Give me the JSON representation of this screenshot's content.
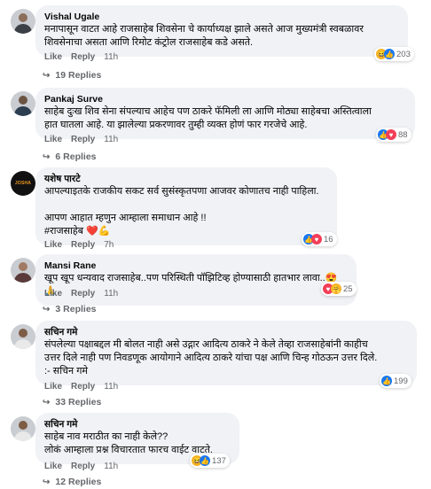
{
  "comments": [
    {
      "author": "Vishal Ugale",
      "text": "मनापासून वाटत आहे राजसाहेब शिवसेना चे कार्याध्यक्ष झाले असते आज मुख्यमंत्री स्वबळावर\nशिवसेनाचा असता आणि रिमोट कंट्रोल राजसाहेब कडे असते.",
      "like": "Like",
      "reply": "Reply",
      "time": "11h",
      "reaction_count": "203",
      "replies": "19 Replies"
    },
    {
      "author": "Pankaj Surve",
      "text": "साहेब दुःख शिव सेना संपल्याच आहेच पण ठाकरे फॅमिली ला आणि मोठ्या साहेबचा अस्तित्वाला\nहात घातला आहे. या झालेल्या प्रकरणावर तुम्ही व्यक्त होणं फार गरजेचे आहे.",
      "like": "Like",
      "reply": "Reply",
      "time": "11h",
      "reaction_count": "88",
      "replies": "6 Replies"
    },
    {
      "author": "यशेष पारटे",
      "text": "आपल्याइतके राजकीय सकट सर्व सुसंस्कृतपणा आजवर कोणातच नाही पाहिला.\n\nआपण आहात म्हणुन आम्हाला समाधान आहे !!\n",
      "hashtag": "#राजसाहेब ❤️💪",
      "like": "Like",
      "reply": "Reply",
      "time": "7h",
      "reaction_count": "16"
    },
    {
      "author": "Mansi Rane",
      "text": "खूप खूप धन्यवाद राजसाहेब..पण परिस्थिती पॉझिटिव्ह होण्यासाठी हातभार लावा..😍🙏",
      "like": "Like",
      "reply": "Reply",
      "time": "11h",
      "reaction_count": "25",
      "replies": "3 Replies"
    },
    {
      "author": "सचिन गमे",
      "text": "संपलेल्या पक्षाबद्दल मी बोलत नाही असे उद्गार आदित्य ठाकरे ने केले तेव्हा राजसाहेबांनी काहीच\nउत्तर दिले नाही पण निवडणूक आयोगाने आदित्य ठाकरे यांचा पक्ष आणि चिन्ह गोठऊन उत्तर दिले.\n:- सचिन गमे",
      "like": "Like",
      "reply": "Reply",
      "time": "11h",
      "reaction_count": "199",
      "replies": "33 Replies"
    },
    {
      "author": "सचिन गमे",
      "text": "साहेब नाव मराठीत का नाही केले??\nलोकं आम्हाला प्रश्न विचारतात फारच वाईट वाटते.",
      "like": "Like",
      "reply": "Reply",
      "time": "11h",
      "reaction_count": "137",
      "replies": "12 Replies"
    }
  ],
  "avatar_logo_text": "JOSHA",
  "colors": {
    "bubble": "#f0f2f5",
    "secondary_text": "#65676b",
    "like_blue": "#1877f2",
    "love_red": "#f33e58",
    "haha_yellow": "#f7b125"
  }
}
